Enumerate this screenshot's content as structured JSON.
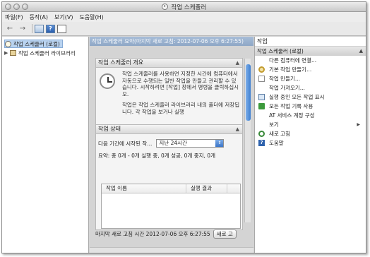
{
  "window": {
    "title": "작업 스케줄러"
  },
  "menu": {
    "items": [
      "파일(F)",
      "동작(A)",
      "보기(V)",
      "도움말(H)"
    ]
  },
  "toolbar": {
    "back": "←",
    "forward": "→",
    "help": "?"
  },
  "tree": {
    "root_label": "작업 스케줄러 (로컬)",
    "child_label": "작업 스케줄러 라이브러리",
    "expand_arrow": "▶"
  },
  "center": {
    "header": "작업 스케줄러 요약(마지막 새로 고침: 2012-07-06 오후 6:27:55)",
    "overview": {
      "title": "작업 스케줄러 개요",
      "para1": "작업 스케줄러를 사용하면 지정한 시간에 컴퓨터에서 자동으로 수행되는 일반 작업을 만들고 관리할 수 있습니다. 시작하려면 [작업] 창에서 명령을 클릭하십시오.",
      "para2": "작업은 작업 스케줄러 라이브러리 내의 폴더에 저장됩니다. 각 작업을 보거나 실행"
    },
    "status": {
      "title": "작업 상태",
      "period_label": "다음 기간에 시작된 작...",
      "period_value": "지난 24시간",
      "summary": "요약: 총 0개 - 0개 실행 중, 0개 성공, 0개 중지, 0개",
      "columns": [
        "작업 이름",
        "실행 결과"
      ]
    },
    "footer": {
      "last_refresh": "마지막 새로 고침 시간 2012-07-06 오후 6:27:55",
      "refresh_button": "새로 고"
    }
  },
  "actions": {
    "title": "작업",
    "group_label": "작업 스케줄러 (로컬)",
    "items": [
      {
        "label": "다른 컴퓨터에 연결...",
        "icon": "blank"
      },
      {
        "label": "기본 작업 만들기...",
        "icon": "gear"
      },
      {
        "label": "작업 만들기...",
        "icon": "page"
      },
      {
        "label": "작업 가져오기...",
        "icon": "blank"
      },
      {
        "label": "실행 중인 모든 작업 표시",
        "icon": "list"
      },
      {
        "label": "모든 작업 기록 사용",
        "icon": "play"
      },
      {
        "label": "AT 서비스 계정 구성",
        "icon": "blank"
      },
      {
        "label": "보기",
        "icon": "blank",
        "submenu": "▶"
      },
      {
        "label": "새로 고침",
        "icon": "refresh"
      },
      {
        "label": "도움말",
        "icon": "help"
      }
    ]
  }
}
